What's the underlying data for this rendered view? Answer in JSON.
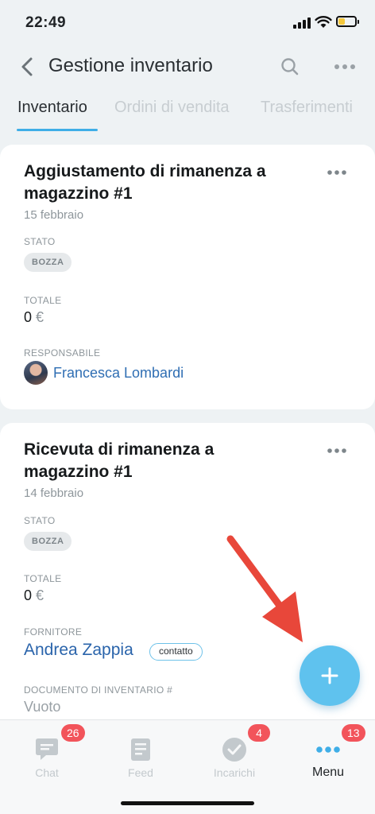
{
  "status_bar": {
    "time": "22:49",
    "battery_color": "#f4c83c"
  },
  "header": {
    "title": "Gestione inventario",
    "back_icon": "chevron-left-icon",
    "search_icon": "search-icon",
    "more_icon": "more-horizontal-icon"
  },
  "tabs": [
    {
      "label": "Inventario",
      "active": true
    },
    {
      "label": "Ordini di vendita",
      "active": false
    },
    {
      "label": "Trasferimenti",
      "active": false
    }
  ],
  "cards": [
    {
      "title": "Aggiustamento di rimanenza a magazzino #1",
      "date": "15 febbraio",
      "status_label": "STATO",
      "status_value": "BOZZA",
      "total_label": "TOTALE",
      "total_amount": "0",
      "total_currency": "€",
      "person_label": "RESPONSABILE",
      "person_name": "Francesca Lombardi"
    },
    {
      "title": "Ricevuta di rimanenza a magazzino #1",
      "date": "14 febbraio",
      "status_label": "STATO",
      "status_value": "BOZZA",
      "total_label": "TOTALE",
      "total_amount": "0",
      "total_currency": "€",
      "person_label": "FORNITORE",
      "person_name": "Andrea Zappia",
      "person_tag": "contatto",
      "doc_label": "DOCUMENTO DI INVENTARIO #",
      "doc_value": "Vuoto"
    }
  ],
  "fab": {
    "icon": "plus-icon",
    "color": "#5fc2ee"
  },
  "annotation": {
    "icon": "red-arrow-icon",
    "color": "#e8473a"
  },
  "tabbar": [
    {
      "label": "Chat",
      "icon": "chat-icon",
      "badge": "26"
    },
    {
      "label": "Feed",
      "icon": "feed-icon",
      "badge": ""
    },
    {
      "label": "Incarichi",
      "icon": "task-check-icon",
      "badge": "4"
    },
    {
      "label": "Menu",
      "icon": "menu-dots-icon",
      "badge": "13",
      "active": true
    }
  ],
  "accent_color": "#3faee7",
  "badge_color": "#f2545b"
}
